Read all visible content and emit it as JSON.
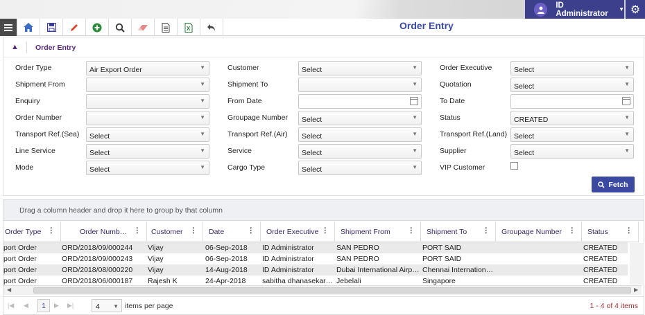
{
  "header": {
    "user_name": "ID Administrator",
    "page_title": "Order Entry"
  },
  "section": {
    "title": "Order Entry"
  },
  "filters": {
    "order_type": {
      "label": "Order Type",
      "value": "Air Export Order"
    },
    "customer": {
      "label": "Customer",
      "value": "Select"
    },
    "order_executive": {
      "label": "Order Executive",
      "value": "Select"
    },
    "shipment_from": {
      "label": "Shipment From",
      "value": ""
    },
    "shipment_to": {
      "label": "Shipment To",
      "value": ""
    },
    "quotation": {
      "label": "Quotation",
      "value": "Select"
    },
    "enquiry": {
      "label": "Enquiry",
      "value": ""
    },
    "from_date": {
      "label": "From Date",
      "value": ""
    },
    "to_date": {
      "label": "To Date",
      "value": ""
    },
    "order_number": {
      "label": "Order Number",
      "value": ""
    },
    "groupage_number": {
      "label": "Groupage Number",
      "value": "Select"
    },
    "status": {
      "label": "Status",
      "value": "CREATED"
    },
    "transport_sea": {
      "label": "Transport Ref.(Sea)",
      "value": "Select"
    },
    "transport_air": {
      "label": "Transport Ref.(Air)",
      "value": "Select"
    },
    "transport_land": {
      "label": "Transport Ref.(Land)",
      "value": "Select"
    },
    "line_service": {
      "label": "Line Service",
      "value": "Select"
    },
    "service": {
      "label": "Service",
      "value": "Select"
    },
    "supplier": {
      "label": "Supplier",
      "value": "Select"
    },
    "mode": {
      "label": "Mode",
      "value": "Select"
    },
    "cargo_type": {
      "label": "Cargo Type",
      "value": "Select"
    },
    "vip_customer": {
      "label": "VIP Customer",
      "checked": false
    }
  },
  "fetch_label": "Fetch",
  "grid": {
    "group_hint": "Drag a column header and drop it here to group by that column",
    "columns": [
      "Order Type",
      "Order Numb…",
      "Customer",
      "Date",
      "Order Executive",
      "Shipment From",
      "Shipment To",
      "Groupage Number",
      "Status"
    ],
    "rows": [
      [
        "port Order",
        "ORD/2018/09/000244",
        "Vijay",
        "06-Sep-2018",
        "ID Administrator",
        "SAN PEDRO",
        "PORT SAID",
        "",
        "CREATED"
      ],
      [
        "port Order",
        "ORD/2018/09/000243",
        "Vijay",
        "06-Sep-2018",
        "ID Administrator",
        "SAN PEDRO",
        "PORT SAID",
        "",
        "CREATED"
      ],
      [
        "port Order",
        "ORD/2018/08/000220",
        "Vijay",
        "14-Aug-2018",
        "ID Administrator",
        "Dubai International Airpo…",
        "Chennai International…",
        "",
        "CREATED"
      ],
      [
        "port Order",
        "ORD/2018/06/000187",
        "Rajesh K",
        "24-Apr-2018",
        "sabitha dhanasekaran",
        "Jebelali",
        "Singapore",
        "",
        "CREATED"
      ]
    ]
  },
  "pager": {
    "page": "1",
    "page_size": "4",
    "items_per_page": "items per page",
    "info": "1 - 4 of 4 items"
  },
  "colors": {
    "brand": "#3b3f8c",
    "title": "#3a4aa8",
    "section": "#5a2a7a",
    "info": "#a23030"
  }
}
